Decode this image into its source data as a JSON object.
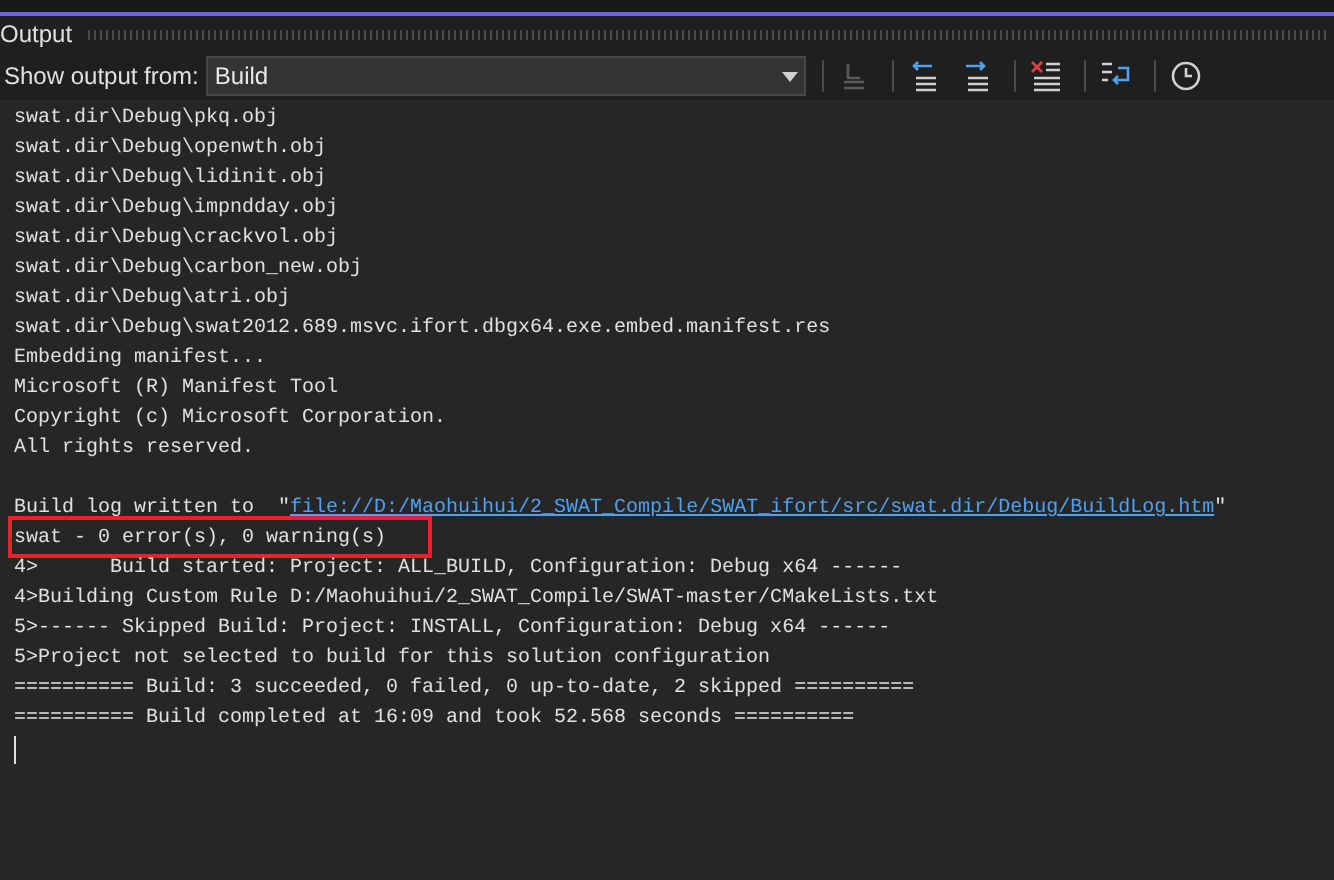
{
  "panel": {
    "title": "Output"
  },
  "toolbar": {
    "label": "Show output from:",
    "source": "Build",
    "buttons": [
      {
        "kind": "goto",
        "disabled": true
      },
      {
        "kind": "prev",
        "disabled": false
      },
      {
        "kind": "next",
        "disabled": false
      },
      {
        "kind": "clear",
        "disabled": false
      },
      {
        "kind": "wrap",
        "disabled": false
      },
      {
        "kind": "clock",
        "disabled": false
      }
    ]
  },
  "lines": [
    {
      "kind": "text",
      "text": "swat.dir\\Debug\\pkq.obj"
    },
    {
      "kind": "text",
      "text": "swat.dir\\Debug\\openwth.obj"
    },
    {
      "kind": "text",
      "text": "swat.dir\\Debug\\lidinit.obj"
    },
    {
      "kind": "text",
      "text": "swat.dir\\Debug\\impndday.obj"
    },
    {
      "kind": "text",
      "text": "swat.dir\\Debug\\crackvol.obj"
    },
    {
      "kind": "text",
      "text": "swat.dir\\Debug\\carbon_new.obj"
    },
    {
      "kind": "text",
      "text": "swat.dir\\Debug\\atri.obj"
    },
    {
      "kind": "text",
      "text": "swat.dir\\Debug\\swat2012.689.msvc.ifort.dbgx64.exe.embed.manifest.res"
    },
    {
      "kind": "text",
      "text": "Embedding manifest..."
    },
    {
      "kind": "text",
      "text": "Microsoft (R) Manifest Tool"
    },
    {
      "kind": "text",
      "text": "Copyright (c) Microsoft Corporation."
    },
    {
      "kind": "text",
      "text": "All rights reserved."
    },
    {
      "kind": "blank"
    },
    {
      "kind": "link",
      "text": "Build log written to  \"",
      "link": "file://D:/Maohuihui/2_SWAT_Compile/SWAT_ifort/src/swat.dir/Debug/BuildLog.htm",
      "suffix": "\""
    },
    {
      "kind": "text",
      "text": "swat - 0 error(s), 0 warning(s)",
      "highlighted": true
    },
    {
      "kind": "text",
      "text": "4>      Build started: Project: ALL_BUILD, Configuration: Debug x64 ------"
    },
    {
      "kind": "text",
      "text": "4>Building Custom Rule D:/Maohuihui/2_SWAT_Compile/SWAT-master/CMakeLists.txt"
    },
    {
      "kind": "text",
      "text": "5>------ Skipped Build: Project: INSTALL, Configuration: Debug x64 ------"
    },
    {
      "kind": "text",
      "text": "5>Project not selected to build for this solution configuration"
    },
    {
      "kind": "text",
      "text": "========== Build: 3 succeeded, 0 failed, 0 up-to-date, 2 skipped =========="
    },
    {
      "kind": "text",
      "text": "========== Build completed at 16:09 and took 52.568 seconds =========="
    },
    {
      "kind": "cursor"
    }
  ]
}
